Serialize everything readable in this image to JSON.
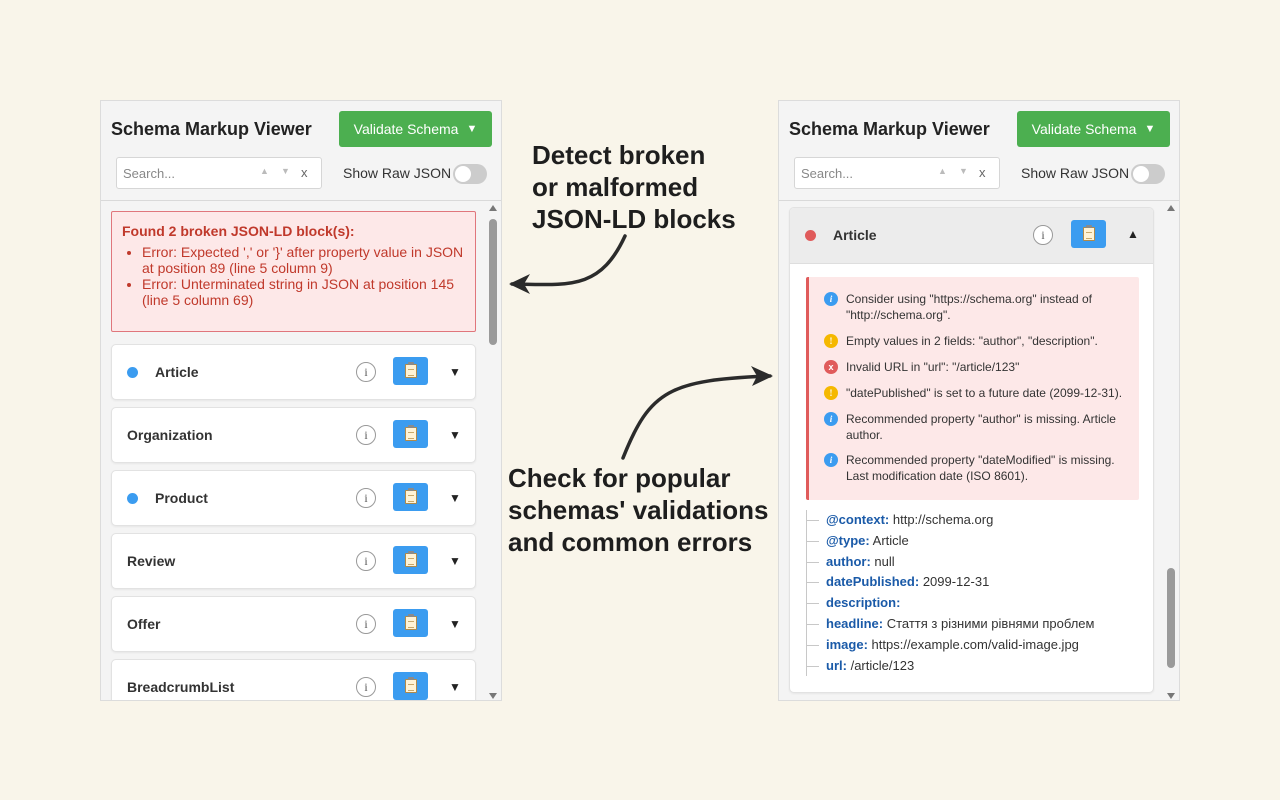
{
  "app": {
    "title": "Schema Markup Viewer",
    "validate_label": "Validate Schema",
    "search_placeholder": "Search...",
    "search_up": "▲",
    "search_down": "▼",
    "search_clear": "x",
    "raw_json_label": "Show Raw JSON",
    "raw_json_enabled": false
  },
  "captions": {
    "detect": [
      "Detect broken",
      "or malformed",
      "JSON-LD blocks"
    ],
    "check": [
      "Check for popular",
      "schemas' validations",
      "and common errors"
    ]
  },
  "left_panel": {
    "errors": {
      "title": "Found 2 broken JSON-LD block(s):",
      "items": [
        "Error: Expected ',' or '}' after property value in JSON at position 89 (line 5 column 9)",
        "Error: Unterminated string in JSON at position 145 (line 5 column 69)"
      ]
    },
    "cards": [
      {
        "name": "Article",
        "status_color": "#3b9cf0",
        "has_dot": true
      },
      {
        "name": "Organization",
        "status_color": "",
        "has_dot": false
      },
      {
        "name": "Product",
        "status_color": "#3b9cf0",
        "has_dot": true
      },
      {
        "name": "Review",
        "status_color": "",
        "has_dot": false
      },
      {
        "name": "Offer",
        "status_color": "",
        "has_dot": false
      },
      {
        "name": "BreadcrumbList",
        "status_color": "",
        "has_dot": false
      }
    ]
  },
  "right_panel": {
    "card": {
      "name": "Article",
      "status_color": "#e05b5b",
      "validations": [
        {
          "level": "info",
          "icon": "i",
          "text": "Consider using \"https://schema.org\" instead of \"http://schema.org\"."
        },
        {
          "level": "warn",
          "icon": "!",
          "text": "Empty values in 2 fields: \"author\", \"description\"."
        },
        {
          "level": "err",
          "icon": "x",
          "text": "Invalid URL in \"url\": \"/article/123\""
        },
        {
          "level": "warn",
          "icon": "!",
          "text": "\"datePublished\" is set to a future date (2099-12-31)."
        },
        {
          "level": "info",
          "icon": "i",
          "text": "Recommended property \"author\" is missing. Article author."
        },
        {
          "level": "info",
          "icon": "i",
          "text": "Recommended property \"dateModified\" is missing. Last modification date (ISO 8601)."
        }
      ],
      "properties": [
        {
          "key": "@context:",
          "value": "http://schema.org"
        },
        {
          "key": "@type:",
          "value": "Article"
        },
        {
          "key": "author:",
          "value": "null"
        },
        {
          "key": "datePublished:",
          "value": "2099-12-31"
        },
        {
          "key": "description:",
          "value": ""
        },
        {
          "key": "headline:",
          "value": "Стаття з різними рівнями проблем"
        },
        {
          "key": "image:",
          "value": "https://example.com/valid-image.jpg"
        },
        {
          "key": "url:",
          "value": "/article/123"
        }
      ]
    }
  },
  "icons": {
    "info": "i",
    "expand": "▼",
    "collapse": "▲",
    "copy": "clipboard-icon"
  },
  "colors": {
    "validate_button": "#4caf50",
    "copy_button": "#3b9cf0",
    "error_text": "#c0392b",
    "error_bg": "#fde8e8",
    "property_key": "#1a5aa8",
    "page_bg": "#f9f5ea"
  }
}
